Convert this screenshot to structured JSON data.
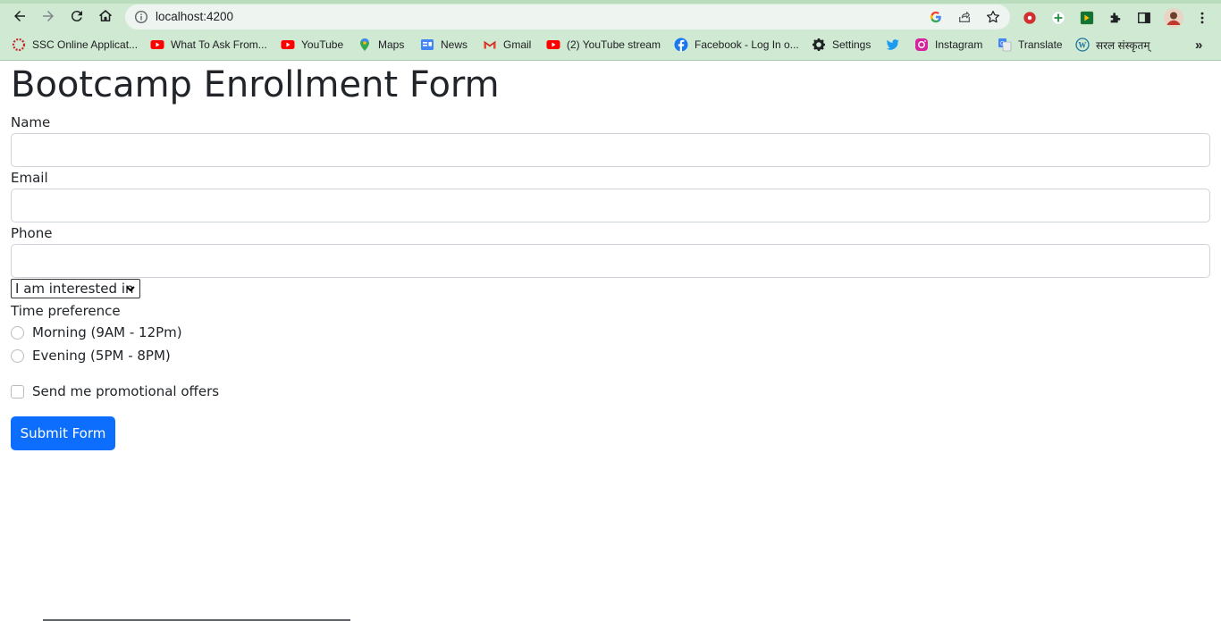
{
  "browser": {
    "url": "localhost:4200",
    "bookmarks": [
      {
        "label": "SSC Online Applicat...",
        "icon": "ssc-icon"
      },
      {
        "label": "What To Ask From...",
        "icon": "youtube-icon"
      },
      {
        "label": "YouTube",
        "icon": "youtube-icon"
      },
      {
        "label": "Maps",
        "icon": "maps-icon"
      },
      {
        "label": "News",
        "icon": "news-icon"
      },
      {
        "label": "Gmail",
        "icon": "gmail-icon"
      },
      {
        "label": "(2) YouTube stream",
        "icon": "youtube-icon"
      },
      {
        "label": "Facebook - Log In o...",
        "icon": "facebook-icon"
      },
      {
        "label": "Settings",
        "icon": "gear-icon"
      },
      {
        "label": "",
        "icon": "twitter-icon"
      },
      {
        "label": "Instagram",
        "icon": "instagram-icon"
      },
      {
        "label": "Translate",
        "icon": "translate-icon"
      },
      {
        "label": "सरल संस्कृतम्",
        "icon": "wordpress-icon"
      }
    ],
    "more_bookmarks": "»"
  },
  "form": {
    "title": "Bootcamp Enrollment Form",
    "name_label": "Name",
    "name_value": "",
    "email_label": "Email",
    "email_value": "",
    "phone_label": "Phone",
    "phone_value": "",
    "interest_select": "I am interested in",
    "time_pref_label": "Time preference",
    "time_options": [
      "Morning (9AM - 12Pm)",
      "Evening (5PM - 8PM)"
    ],
    "promo_label": "Send me promotional offers",
    "submit_label": "Submit Form"
  },
  "colors": {
    "chrome_bg": "#cfe9d2",
    "primary_button": "#0d6efd",
    "text": "#212529"
  }
}
